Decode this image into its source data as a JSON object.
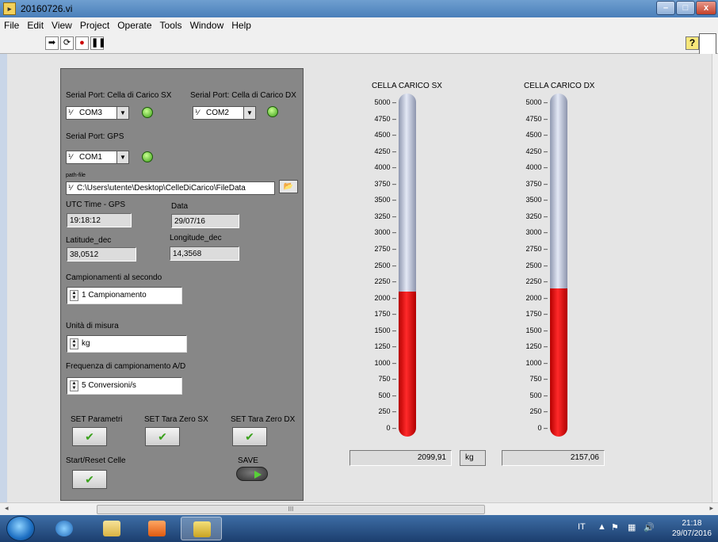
{
  "window": {
    "title": "20160726.vi",
    "minimize": "–",
    "maximize": "□",
    "close": "x"
  },
  "menu": [
    "File",
    "Edit",
    "View",
    "Project",
    "Operate",
    "Tools",
    "Window",
    "Help"
  ],
  "toolbar": {
    "help": "?"
  },
  "panel": {
    "serial_sx": {
      "label": "Serial Port: Cella di Carico SX",
      "value": "COM3"
    },
    "serial_dx": {
      "label": "Serial Port: Cella di Carico DX",
      "value": "COM2"
    },
    "serial_gps": {
      "label": "Serial Port: GPS",
      "value": "COM1"
    },
    "path": {
      "label": "path-file",
      "value": "C:\\Users\\utente\\Desktop\\CelleDiCarico\\FileData"
    },
    "utc": {
      "label": "UTC Time - GPS",
      "value": "19:18:12"
    },
    "data": {
      "label": "Data",
      "value": "29/07/16"
    },
    "lat": {
      "label": "Latitude_dec",
      "value": "38,0512"
    },
    "lon": {
      "label": "Longitude_dec",
      "value": "14,3568"
    },
    "campionamenti": {
      "label": "Campionamenti al secondo",
      "value": "1 Campionamento"
    },
    "unita": {
      "label": "Unità di misura",
      "value": "kg"
    },
    "frequenza": {
      "label": "Frequenza di campionamento A/D",
      "value": "5 Conversioni/s"
    },
    "buttons": {
      "set_parametri": "SET Parametri",
      "set_tara_sx": "SET Tara Zero SX",
      "set_tara_dx": "SET Tara Zero DX",
      "start_reset": "Start/Reset Celle",
      "save": "SAVE"
    }
  },
  "thermometers": {
    "ticks": [
      "5000",
      "4750",
      "4500",
      "4250",
      "4000",
      "3750",
      "3500",
      "3250",
      "3000",
      "2750",
      "2500",
      "2250",
      "2000",
      "1750",
      "1500",
      "1250",
      "1000",
      "750",
      "500",
      "250",
      "0"
    ],
    "max": 5000,
    "sx": {
      "title": "CELLA CARICO SX",
      "value": 2099.91,
      "display": "2099,91"
    },
    "dx": {
      "title": "CELLA CARICO DX",
      "value": 2157.06,
      "display": "2157,06"
    },
    "unit": "kg"
  },
  "scrollbar": {
    "grip": "III"
  },
  "taskbar": {
    "lang": "IT",
    "time": "21:18",
    "date": "29/07/2016"
  },
  "colors": {
    "led_on": "#3ca019",
    "fill": "#e00000",
    "cluster": "#878787"
  }
}
